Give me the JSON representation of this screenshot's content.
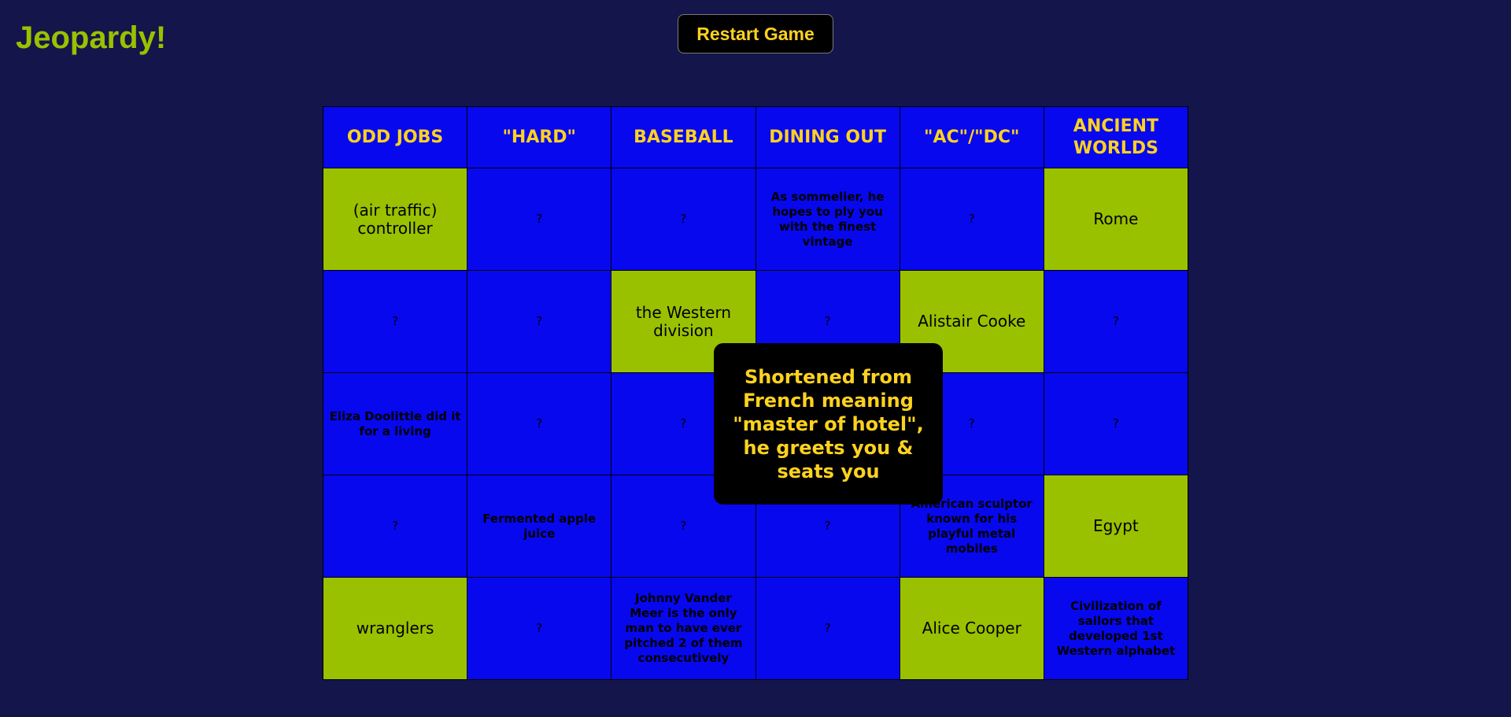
{
  "header": {
    "title": "Jeopardy!",
    "restart_label": "Restart Game"
  },
  "colors": {
    "background": "#14154a",
    "cell_blue": "#0808ee",
    "answered_green": "#9ac100",
    "header_text": "#ffd21f"
  },
  "board": {
    "categories": [
      "ODD JOBS",
      "\"HARD\"",
      "BASEBALL",
      "DINING OUT",
      "\"AC\"/\"DC\"",
      "ANCIENT WORLDS"
    ],
    "rows": [
      [
        {
          "text": "(air traffic) controller",
          "state": "answered"
        },
        {
          "text": "?",
          "state": "hidden"
        },
        {
          "text": "?",
          "state": "hidden"
        },
        {
          "text": "As sommelier, he hopes to ply you with the finest vintage",
          "state": "question"
        },
        {
          "text": "?",
          "state": "hidden"
        },
        {
          "text": "Rome",
          "state": "answered"
        }
      ],
      [
        {
          "text": "?",
          "state": "hidden"
        },
        {
          "text": "?",
          "state": "hidden"
        },
        {
          "text": "the Western division",
          "state": "answered"
        },
        {
          "text": "?",
          "state": "hidden"
        },
        {
          "text": "Alistair Cooke",
          "state": "answered"
        },
        {
          "text": "?",
          "state": "hidden"
        }
      ],
      [
        {
          "text": "Eliza Doolittle did it for a living",
          "state": "question"
        },
        {
          "text": "?",
          "state": "hidden"
        },
        {
          "text": "?",
          "state": "hidden"
        },
        {
          "text": "",
          "state": "hidden"
        },
        {
          "text": "?",
          "state": "hidden"
        },
        {
          "text": "?",
          "state": "hidden"
        }
      ],
      [
        {
          "text": "?",
          "state": "hidden"
        },
        {
          "text": "Fermented apple juice",
          "state": "question"
        },
        {
          "text": "?",
          "state": "hidden"
        },
        {
          "text": "?",
          "state": "hidden"
        },
        {
          "text": "American sculptor known for his playful metal mobiles",
          "state": "question"
        },
        {
          "text": "Egypt",
          "state": "answered"
        }
      ],
      [
        {
          "text": "wranglers",
          "state": "answered"
        },
        {
          "text": "?",
          "state": "hidden"
        },
        {
          "text": "Johnny Vander Meer is the only man to have ever pitched 2 of them consecutively",
          "state": "question"
        },
        {
          "text": "?",
          "state": "hidden"
        },
        {
          "text": "Alice Cooper",
          "state": "answered"
        },
        {
          "text": "Civilization of sailors that developed 1st Western alphabet",
          "state": "question"
        }
      ]
    ]
  },
  "popup": {
    "clue": "Shortened from French meaning \"master of hotel\", he greets you & seats you"
  }
}
